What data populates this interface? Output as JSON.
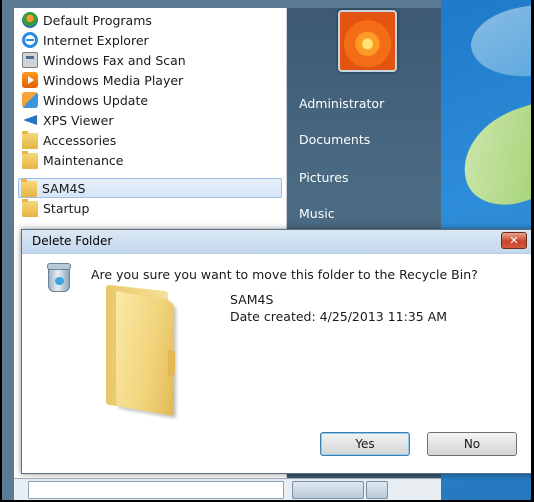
{
  "start_menu": {
    "programs": [
      {
        "label": "Default Programs",
        "icon": "default-programs-icon"
      },
      {
        "label": "Internet Explorer",
        "icon": "internet-explorer-icon"
      },
      {
        "label": "Windows Fax and Scan",
        "icon": "fax-scan-icon"
      },
      {
        "label": "Windows Media Player",
        "icon": "media-player-icon"
      },
      {
        "label": "Windows Update",
        "icon": "windows-update-icon"
      },
      {
        "label": "XPS Viewer",
        "icon": "xps-viewer-icon"
      },
      {
        "label": "Accessories",
        "icon": "folder-icon"
      },
      {
        "label": "Maintenance",
        "icon": "folder-icon"
      },
      {
        "label": "SAM4S",
        "icon": "folder-icon",
        "selected": true
      },
      {
        "label": "Startup",
        "icon": "folder-icon"
      }
    ],
    "right_links": [
      "Administrator",
      "Documents",
      "Pictures",
      "Music"
    ]
  },
  "dialog": {
    "title": "Delete Folder",
    "close_label": "✕",
    "question": "Are you sure you want to move this folder to the Recycle Bin?",
    "folder_name": "SAM4S",
    "date_created": "Date created: 4/25/2013 11:35 AM",
    "yes_label": "Yes",
    "no_label": "No"
  },
  "colors": {
    "selection": "#d6e6f7",
    "right_pane": "#4b6b84",
    "close_button": "#c7452d"
  }
}
